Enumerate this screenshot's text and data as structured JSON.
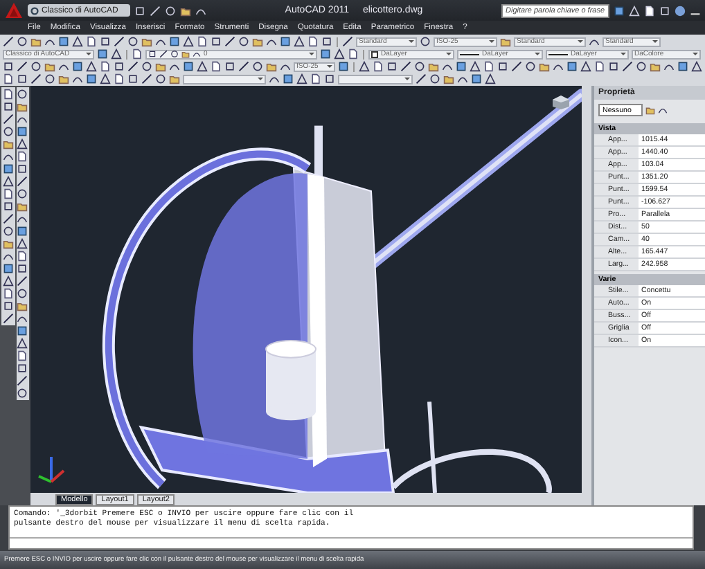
{
  "title_bar": {
    "workspace": "Classico di AutoCAD",
    "title": "AutoCAD 2011",
    "file": "elicottero.dwg",
    "search": {
      "placeholder": "Digitare parola chiave o frase"
    }
  },
  "menu_bar": [
    "File",
    "Modifica",
    "Visualizza",
    "Inserisci",
    "Formato",
    "Strumenti",
    "Disegna",
    "Quotatura",
    "Edita",
    "Parametrico",
    "Finestra",
    "?"
  ],
  "toolbars": {
    "row_1": {
      "styles": [
        "Standard",
        "ISO-25",
        "Standard",
        "Standard"
      ]
    },
    "row_2": {
      "workspace": "Classico di AutoCAD",
      "layer": "0",
      "object_color": "DaLayer",
      "linetype": "DaLayer",
      "lineweight": "DaLayer",
      "plot_style": "DaColore"
    },
    "row_3": {
      "dimension_style": "ISO-25"
    }
  },
  "layout_tabs": [
    {
      "label": "Modello",
      "selected": true
    },
    {
      "label": "Layout1",
      "selected": false
    },
    {
      "label": "Layout2",
      "selected": false
    }
  ],
  "properties": {
    "title": "Proprietà",
    "selection": "Nessuno",
    "sections": [
      {
        "title": "Vista",
        "rows": [
          {
            "label": "App...",
            "value": "1015.44"
          },
          {
            "label": "App...",
            "value": "1440.40"
          },
          {
            "label": "App...",
            "value": "103.04"
          },
          {
            "label": "Punt...",
            "value": "1351.20"
          },
          {
            "label": "Punt...",
            "value": "1599.54"
          },
          {
            "label": "Punt...",
            "value": "-106.627"
          },
          {
            "label": "Pro...",
            "value": "Parallela"
          },
          {
            "label": "Dist...",
            "value": "50"
          },
          {
            "label": "Cam...",
            "value": "40"
          },
          {
            "label": "Alte...",
            "value": "165.447"
          },
          {
            "label": "Larg...",
            "value": "242.958"
          }
        ]
      },
      {
        "title": "Varie",
        "rows": [
          {
            "label": "Stile...",
            "value": "Concettu"
          },
          {
            "label": "Auto...",
            "value": "On"
          },
          {
            "label": "Buss...",
            "value": "Off"
          },
          {
            "label": "Griglia",
            "value": "Off"
          },
          {
            "label": "Icon...",
            "value": "On"
          }
        ]
      }
    ]
  },
  "command_line": {
    "lines": [
      "Comando: '_3dorbit Premere ESC o INVIO per uscire oppure fare clic con il",
      "pulsante destro del mouse per visualizzare il menu di scelta rapida."
    ]
  },
  "status_bar": {
    "message": "Premere ESC o INVIO per uscire oppure fare clic con il pulsante destro del mouse per visualizzare il menu di scelta rapida"
  }
}
